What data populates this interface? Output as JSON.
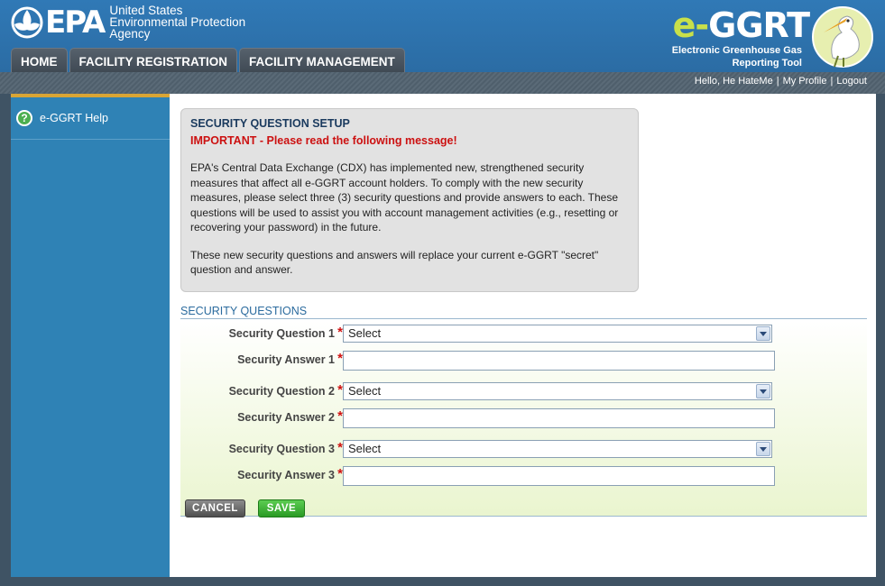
{
  "header": {
    "agency_logo": "EPA",
    "agency_lines": [
      "United States",
      "Environmental Protection",
      "Agency"
    ],
    "app_name": "e-GGRT",
    "app_name_prefix": "e-",
    "app_name_main": "GGRT",
    "app_subtitle_line1": "Electronic Greenhouse Gas",
    "app_subtitle_line2": "Reporting Tool",
    "bird_icon": "egret-logo-icon"
  },
  "nav": {
    "tabs": [
      "HOME",
      "FACILITY REGISTRATION",
      "FACILITY MANAGEMENT"
    ]
  },
  "userbar": {
    "greeting": "Hello, He HateMe",
    "separator": "|",
    "profile": "My Profile",
    "logout": "Logout"
  },
  "sidebar": {
    "help_label": "e-GGRT Help",
    "help_icon": "question-circle-icon"
  },
  "message": {
    "title": "SECURITY QUESTION SETUP",
    "important": "IMPORTANT - Please read the following message!",
    "paragraph1": "EPA's Central Data Exchange (CDX) has implemented new, strengthened security measures that affect all e-GGRT account holders. To comply with the new security measures, please select three (3) security questions and provide answers to each. These questions will be used to assist you with account management activities (e.g., resetting or recovering your password) in the future.",
    "paragraph2": "These new security questions and answers will replace your current e-GGRT \"secret\" question and answer."
  },
  "form": {
    "section_title": "SECURITY QUESTIONS",
    "required_marker": "*",
    "q1_label": "Security Question 1",
    "a1_label": "Security Answer 1",
    "q2_label": "Security Question 2",
    "a2_label": "Security Answer 2",
    "q3_label": "Security Question 3",
    "a3_label": "Security Answer 3",
    "q1_value": "Select",
    "q2_value": "Select",
    "q3_value": "Select",
    "a1_value": "",
    "a2_value": "",
    "a3_value": "",
    "cancel_label": "CANCEL",
    "save_label": "SAVE"
  },
  "colors": {
    "header_blue": "#2d73b0",
    "sidebar_blue": "#2f82b5",
    "important_red": "#cc1111",
    "save_green": "#2a9a24",
    "accent_lime": "#c8e04a"
  }
}
